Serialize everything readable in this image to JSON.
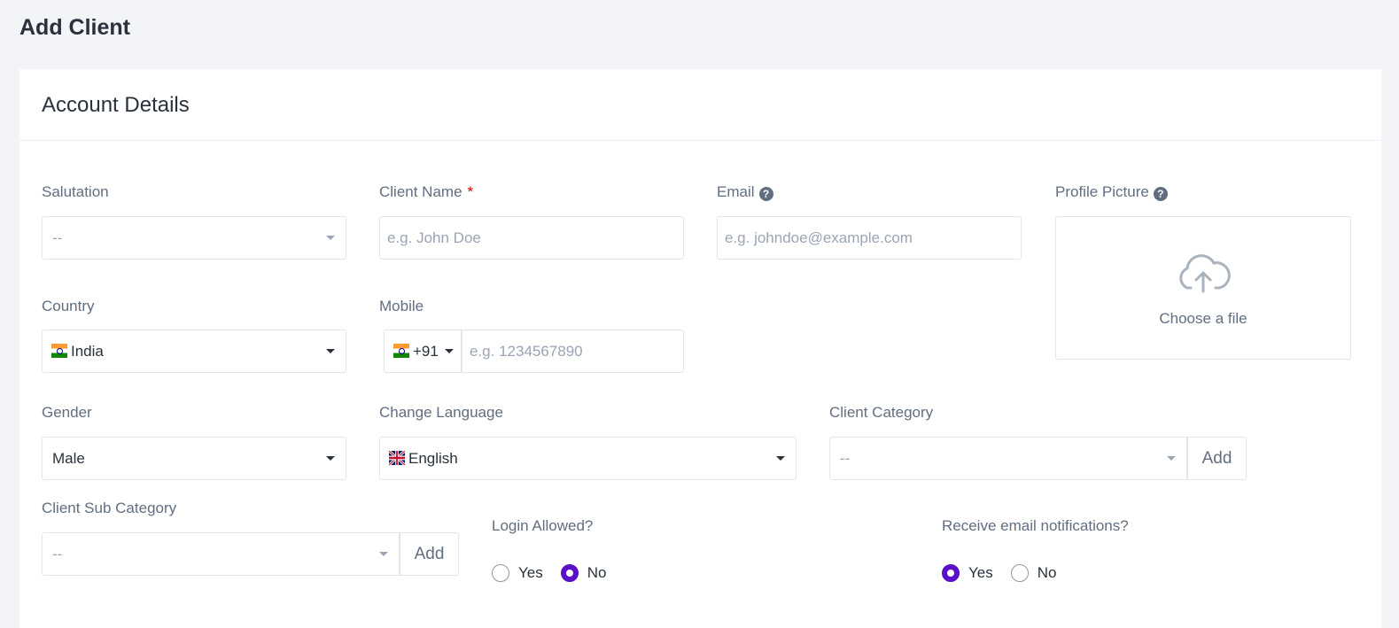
{
  "page": {
    "title": "Add Client"
  },
  "card": {
    "title": "Account Details"
  },
  "salutation": {
    "label": "Salutation",
    "value": "--"
  },
  "client_name": {
    "label": "Client Name",
    "required_mark": "*",
    "placeholder": "e.g. John Doe"
  },
  "email": {
    "label": "Email",
    "help": "?",
    "placeholder": "e.g. johndoe@example.com"
  },
  "profile_picture": {
    "label": "Profile Picture",
    "help": "?",
    "upload_text": "Choose a file"
  },
  "country": {
    "label": "Country",
    "value": "India"
  },
  "mobile": {
    "label": "Mobile",
    "code": "+91",
    "placeholder": "e.g. 1234567890"
  },
  "gender": {
    "label": "Gender",
    "value": "Male"
  },
  "language": {
    "label": "Change Language",
    "value": "English"
  },
  "client_category": {
    "label": "Client Category",
    "value": "--",
    "add_label": "Add"
  },
  "client_sub_category": {
    "label": "Client Sub Category",
    "value": "--",
    "add_label": "Add"
  },
  "login_allowed": {
    "label": "Login Allowed?",
    "options": [
      {
        "label": "Yes",
        "checked": false
      },
      {
        "label": "No",
        "checked": true
      }
    ]
  },
  "email_notifications": {
    "label": "Receive email notifications?",
    "options": [
      {
        "label": "Yes",
        "checked": true
      },
      {
        "label": "No",
        "checked": false
      }
    ]
  },
  "colors": {
    "accent": "#5a0fc8",
    "required": "#d30000"
  }
}
